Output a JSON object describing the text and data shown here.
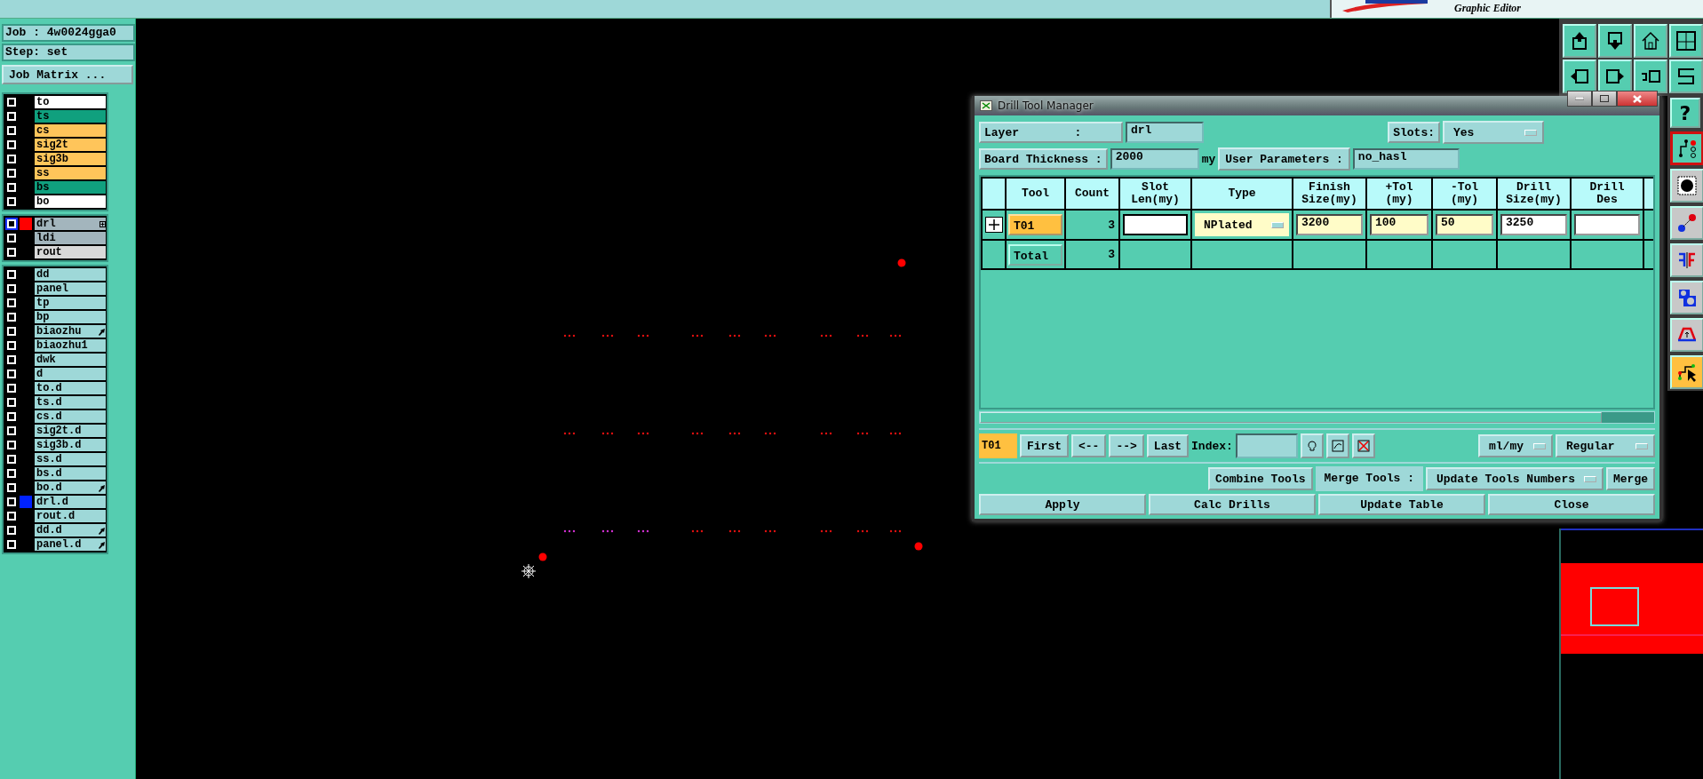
{
  "top_bar": {
    "subtitle": "Graphic Editor"
  },
  "job": {
    "job": "Job : 4w0024gga0",
    "step": "Step: set",
    "matrix_button": "Job Matrix ..."
  },
  "layer_groups": [
    {
      "layers": [
        {
          "name": "to",
          "kind": "silk_screen",
          "checked": false,
          "selected": false,
          "expandable": false,
          "linked": false
        },
        {
          "name": "ts",
          "kind": "solder_mask",
          "checked": false,
          "selected": false,
          "expandable": false,
          "linked": false
        },
        {
          "name": "cs",
          "kind": "signal",
          "checked": false,
          "selected": false,
          "expandable": false,
          "linked": false
        },
        {
          "name": "sig2t",
          "kind": "signal",
          "checked": false,
          "selected": false,
          "expandable": false,
          "linked": false
        },
        {
          "name": "sig3b",
          "kind": "signal",
          "checked": false,
          "selected": false,
          "expandable": false,
          "linked": false
        },
        {
          "name": "ss",
          "kind": "signal",
          "checked": false,
          "selected": false,
          "expandable": false,
          "linked": false
        },
        {
          "name": "bs",
          "kind": "solder_mask",
          "checked": false,
          "selected": false,
          "expandable": false,
          "linked": false
        },
        {
          "name": "bo",
          "kind": "silk_screen",
          "checked": false,
          "selected": false,
          "expandable": false,
          "linked": false
        }
      ]
    },
    {
      "layers": [
        {
          "name": "drl",
          "kind": "drill",
          "color": "#ff0000",
          "checked": false,
          "selected": true,
          "expandable": true,
          "linked": false
        },
        {
          "name": "ldi",
          "kind": "drill",
          "checked": false,
          "selected": false,
          "expandable": false,
          "linked": false
        },
        {
          "name": "rout",
          "kind": "rout",
          "checked": false,
          "selected": false,
          "expandable": false,
          "linked": false
        }
      ]
    },
    {
      "layers": [
        {
          "name": "dd",
          "kind": "document",
          "checked": false,
          "selected": false,
          "expandable": false,
          "linked": false
        },
        {
          "name": "panel",
          "kind": "document",
          "checked": false,
          "selected": false,
          "expandable": false,
          "linked": false
        },
        {
          "name": "tp",
          "kind": "document",
          "checked": false,
          "selected": false,
          "expandable": false,
          "linked": false
        },
        {
          "name": "bp",
          "kind": "document",
          "checked": false,
          "selected": false,
          "expandable": false,
          "linked": false
        },
        {
          "name": "biaozhu",
          "kind": "document",
          "checked": false,
          "selected": false,
          "expandable": false,
          "linked": true
        },
        {
          "name": "biaozhu1",
          "kind": "document",
          "checked": false,
          "selected": false,
          "expandable": false,
          "linked": false
        },
        {
          "name": "dwk",
          "kind": "document",
          "checked": false,
          "selected": false,
          "expandable": false,
          "linked": false
        },
        {
          "name": "d",
          "kind": "document",
          "checked": false,
          "selected": false,
          "expandable": false,
          "linked": false
        },
        {
          "name": "to.d",
          "kind": "document",
          "checked": false,
          "selected": false,
          "expandable": false,
          "linked": false
        },
        {
          "name": "ts.d",
          "kind": "document",
          "checked": false,
          "selected": false,
          "expandable": false,
          "linked": false
        },
        {
          "name": "cs.d",
          "kind": "document",
          "checked": false,
          "selected": false,
          "expandable": false,
          "linked": false
        },
        {
          "name": "sig2t.d",
          "kind": "document",
          "checked": false,
          "selected": false,
          "expandable": false,
          "linked": false
        },
        {
          "name": "sig3b.d",
          "kind": "document",
          "checked": false,
          "selected": false,
          "expandable": false,
          "linked": false
        },
        {
          "name": "ss.d",
          "kind": "document",
          "checked": false,
          "selected": false,
          "expandable": false,
          "linked": false
        },
        {
          "name": "bs.d",
          "kind": "document",
          "checked": false,
          "selected": false,
          "expandable": false,
          "linked": false
        },
        {
          "name": "bo.d",
          "kind": "document",
          "checked": false,
          "selected": false,
          "expandable": false,
          "linked": true
        },
        {
          "name": "drl.d",
          "kind": "document",
          "color": "#0022ff",
          "checked": false,
          "selected": false,
          "expandable": false,
          "linked": false
        },
        {
          "name": "rout.d",
          "kind": "document",
          "checked": false,
          "selected": false,
          "expandable": false,
          "linked": false
        },
        {
          "name": "dd.d",
          "kind": "document",
          "checked": false,
          "selected": false,
          "expandable": false,
          "linked": true
        },
        {
          "name": "panel.d",
          "kind": "document",
          "checked": false,
          "selected": false,
          "expandable": false,
          "linked": true
        }
      ]
    }
  ],
  "toolbar": {
    "help": "?",
    "tools": [
      {
        "kind": "highlight",
        "selected": true
      },
      {
        "kind": "pad",
        "selected": false
      },
      {
        "kind": "connect",
        "selected": false
      },
      {
        "kind": "mirror",
        "selected": false
      },
      {
        "kind": "shapes",
        "selected": false
      },
      {
        "kind": "arc",
        "selected": false
      },
      {
        "kind": "route",
        "selected": true
      }
    ]
  },
  "dialog": {
    "title": "Drill Tool Manager",
    "layer": {
      "label": "Layer        :",
      "value": "drl"
    },
    "slots": {
      "label": "Slots:",
      "value": "Yes"
    },
    "board_thickness": {
      "label": "Board Thickness :",
      "value": "2000",
      "unit": "my"
    },
    "user_parameters": {
      "label": "User Parameters :",
      "value": "no_hasl"
    },
    "table": {
      "columns": [
        "Tool",
        "Count",
        "Slot\nLen(my)",
        "Type",
        "Finish\nSize(my)",
        "+Tol\n(my)",
        "-Tol\n(my)",
        "Drill\nSize(my)",
        "Drill\nDes"
      ],
      "rows": [
        {
          "tool": "T01",
          "count": "3",
          "type": "NPlated",
          "finish_size": "3200",
          "plus_tol": "100",
          "minus_tol": "50",
          "drill_size": "3250"
        }
      ],
      "total": {
        "label": "Total",
        "count": "3"
      }
    },
    "navigation": {
      "current": "T01",
      "buttons": [
        "First",
        "<--",
        "-->",
        "Last"
      ],
      "index_label": "Index:",
      "units": "ml/my",
      "mode": "Regular"
    },
    "merge": {
      "combine": "Combine Tools",
      "label": "Merge Tools :",
      "option": "Update Tools Numbers",
      "button": "Merge"
    },
    "actions": [
      "Apply",
      "Calc Drills",
      "Update Table",
      "Close"
    ]
  }
}
